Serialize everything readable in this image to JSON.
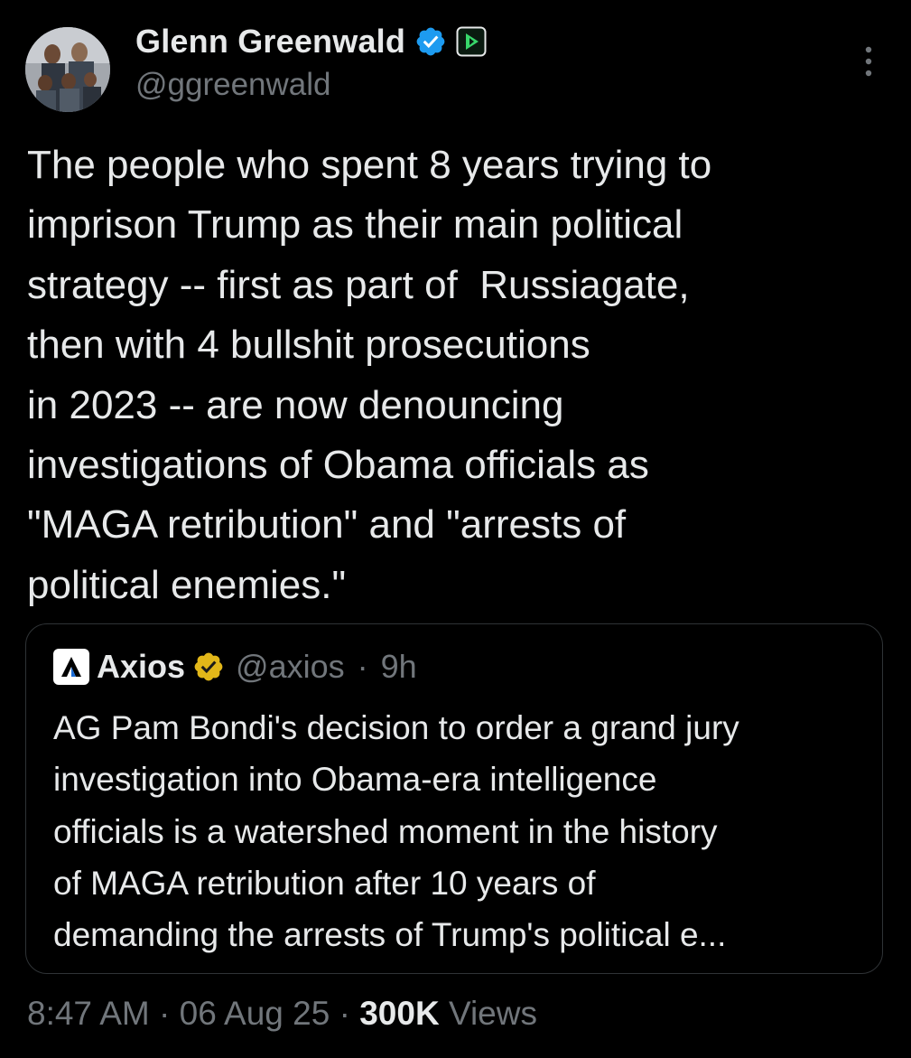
{
  "author": {
    "name": "Glenn Greenwald",
    "handle": "@ggreenwald",
    "verified_color": "#1d9bf0",
    "affiliate_icon": "play-video-icon"
  },
  "tweet": {
    "lines": [
      "The people who spent 8 years trying to",
      "imprison Trump as their main political",
      "strategy -- first as part of  Russiagate,",
      "then with 4 bullshit prosecutions",
      "in 2023 -- are now denouncing",
      "investigations of Obama officials as",
      "\"MAGA retribution\" and \"arrests of",
      "political enemies.\""
    ]
  },
  "quote": {
    "name": "Axios",
    "handle": "@axios",
    "separator": "·",
    "time": "9h",
    "badge_color": "#e2b719",
    "lines": [
      "AG Pam Bondi's decision to order a grand jury",
      "investigation into Obama-era intelligence",
      "officials is a watershed moment in the history",
      "of MAGA retribution after 10 years of",
      "demanding the arrests of Trump's political e..."
    ]
  },
  "footer": {
    "time": "8:47 AM",
    "sep1": "·",
    "date": "06 Aug 25",
    "sep2": "·",
    "views_count": "300K",
    "views_label": "Views"
  }
}
